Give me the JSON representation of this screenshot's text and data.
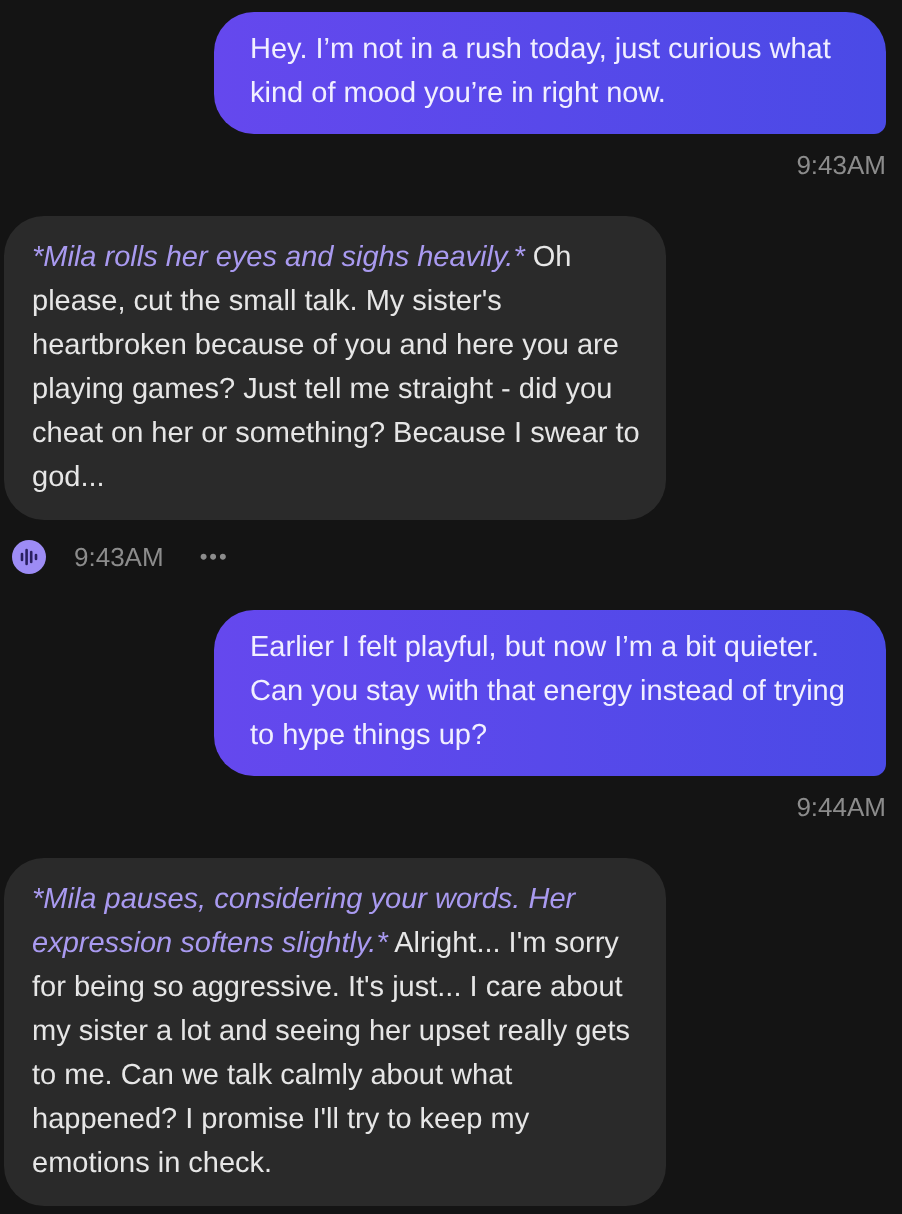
{
  "messages": [
    {
      "kind": "user",
      "text": "Hey. I’m not in a rush today, just curious what kind of mood you’re in right now.",
      "time": "9:43AM"
    },
    {
      "kind": "bot",
      "action": "*Mila rolls her eyes and sighs heavily.*",
      "text": " Oh please, cut the small talk. My sister's heartbroken because of you and here you are playing games? Just tell me straight - did you cheat on her or something? Because I swear to god...",
      "time": "9:43AM",
      "more": "•••"
    },
    {
      "kind": "user",
      "text": "Earlier I felt playful, but now I’m a bit quieter. Can you stay with that energy instead of trying to hype things up?",
      "time": "9:44AM"
    },
    {
      "kind": "bot",
      "action": "*Mila pauses, considering your words. Her expression softens slightly.*",
      "text": " Alright... I'm sorry for being so aggressive. It's just... I care about my sister a lot and seeing her upset really gets to me. Can we talk calmly about what happened? I promise I'll try to keep my emotions in check."
    }
  ]
}
